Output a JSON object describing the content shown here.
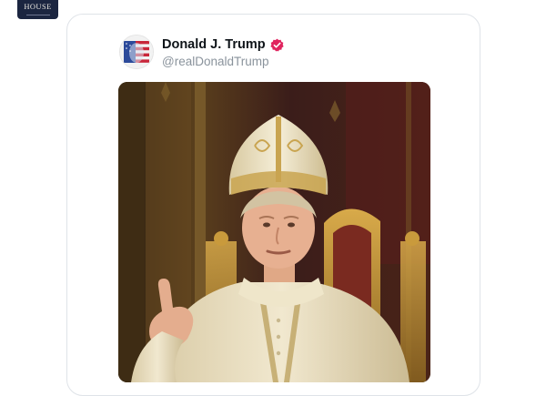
{
  "logo": {
    "text": "HOUSE"
  },
  "post": {
    "author_name": "Donald J. Trump",
    "handle": "@realDonaldTrump",
    "verified": true,
    "verified_color": "#e0245e"
  },
  "colors": {
    "logo_bg": "#1b2540",
    "card_border": "#dfe3e8",
    "handle_text": "#8a939c"
  }
}
